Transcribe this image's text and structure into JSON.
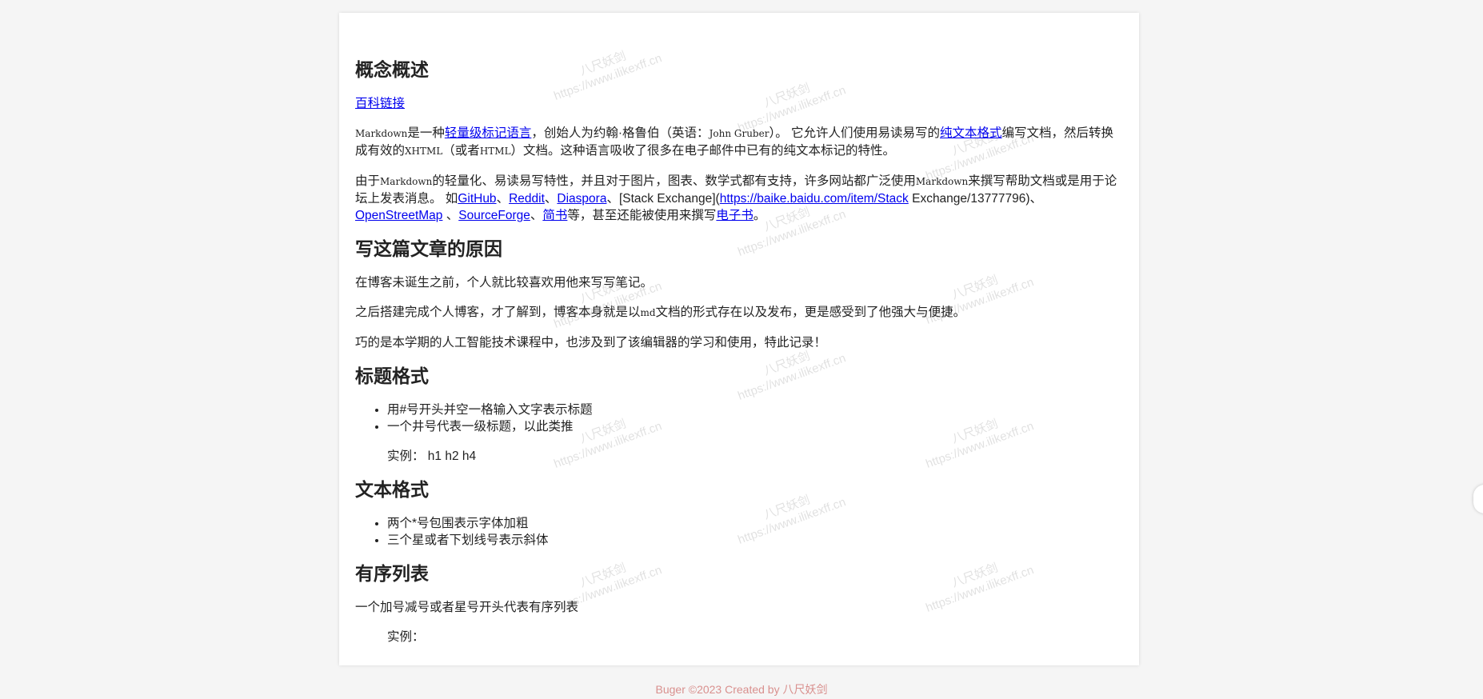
{
  "watermark": {
    "line1": "八尺妖剑",
    "line2": "https://www.ilikexff.cn"
  },
  "section1": {
    "heading": "概念概述",
    "baike_link": "百科链接",
    "p1": {
      "t1": "Markdown",
      "t2": "是一种",
      "link1": "轻量级标记语言",
      "t3": "，创始人为约翰·格鲁伯（英语：",
      "t4": "John Gruber",
      "t5": "）。 它允许人们使用易读易写的",
      "link2": "纯文本格式",
      "t6": "编写文档，然后转换成有效的",
      "t7": "XHTML",
      "t8": "（或者",
      "t9": "HTML",
      "t10": "）文档。这种语言吸收了很多在电子邮件中已有的纯文本标记的特性。"
    },
    "p2": {
      "t1": "由于",
      "t2": "Markdown",
      "t3": "的轻量化、易读易写特性，并且对于图片，图表、数学式都有支持，许多网站都广泛使用",
      "t4": "Markdown",
      "t5": "来撰写帮助文档或是用于论坛上发表消息。 如",
      "link_github": "GitHub",
      "sep1": "、",
      "link_reddit": "Reddit",
      "sep2": "、",
      "link_diaspora": "Diaspora",
      "t6": "、[Stack Exchange](",
      "link_baike": "https://baike.baidu.com/item/Stack",
      "t7": " Exchange/13777796)、",
      "link_osm": "OpenStreetMap",
      "sep3": " 、",
      "link_sf": "SourceForge",
      "sep4": "、",
      "link_jianshu": "简书",
      "t8": "等，甚至还能被使用来撰写",
      "link_ebook": "电子书",
      "t9": "。"
    }
  },
  "section2": {
    "heading": "写这篇文章的原因",
    "p1": "在博客未诞生之前，个人就比较喜欢用他来写写笔记。",
    "p2_a": "之后搭建完成个人博客，才了解到，博客本身就是以",
    "p2_md": "md",
    "p2_b": "文档的形式存在以及发布，更是感受到了他强大与便捷。",
    "p3": "巧的是本学期的人工智能技术课程中，也涉及到了该编辑器的学习和使用，特此记录！"
  },
  "section3": {
    "heading": "标题格式",
    "items": [
      "用#号开头并空一格输入文字表示标题",
      "一个井号代表一级标题，以此类推"
    ],
    "example": "实例：  h1 h2 h4"
  },
  "section4": {
    "heading": "文本格式",
    "items": [
      "两个*号包围表示字体加粗",
      "三个星或者下划线号表示斜体"
    ]
  },
  "section5": {
    "heading": "有序列表",
    "p1": "一个加号减号或者星号开头代表有序列表",
    "example": "实例："
  },
  "footer": {
    "text": "Buger ©2023 Created by 八尺妖剑"
  }
}
